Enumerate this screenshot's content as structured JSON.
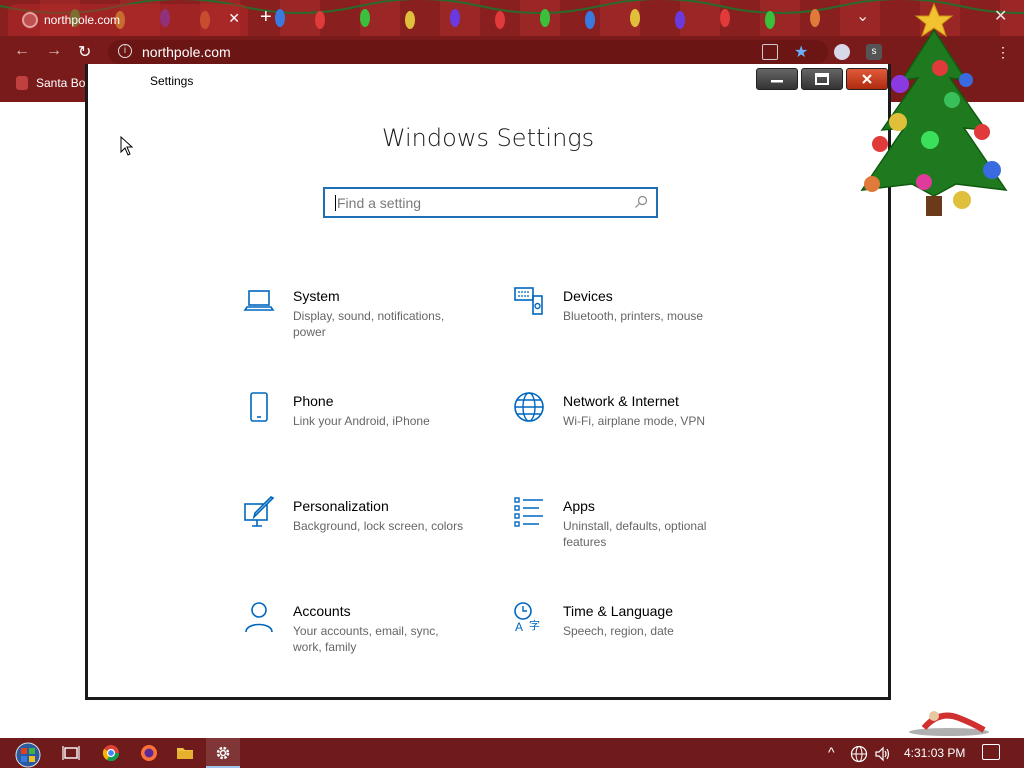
{
  "browser": {
    "tab_title": "northpole.com",
    "address": "northpole.com",
    "bookmark_label": "Santa Bo"
  },
  "settings": {
    "window_title": "Settings",
    "heading": "Windows Settings",
    "search_placeholder": "Find a setting",
    "categories": [
      {
        "name": "System",
        "desc": "Display, sound, notifications, power",
        "icon": "laptop-icon"
      },
      {
        "name": "Devices",
        "desc": "Bluetooth, printers, mouse",
        "icon": "devices-icon"
      },
      {
        "name": "Phone",
        "desc": "Link your Android, iPhone",
        "icon": "phone-icon"
      },
      {
        "name": "Network & Internet",
        "desc": "Wi-Fi, airplane mode, VPN",
        "icon": "globe-icon"
      },
      {
        "name": "Personalization",
        "desc": "Background, lock screen, colors",
        "icon": "paintbrush-icon"
      },
      {
        "name": "Apps",
        "desc": "Uninstall, defaults, optional features",
        "icon": "apps-list-icon"
      },
      {
        "name": "Accounts",
        "desc": "Your accounts, email, sync, work, family",
        "icon": "person-icon"
      },
      {
        "name": "Time & Language",
        "desc": "Speech, region, date",
        "icon": "time-language-icon"
      }
    ]
  },
  "taskbar": {
    "clock": "4:31:03 PM"
  },
  "colors": {
    "accent": "#0067c0",
    "browser_red": "#7c1a1a",
    "taskbar": "#6f1b1b"
  }
}
